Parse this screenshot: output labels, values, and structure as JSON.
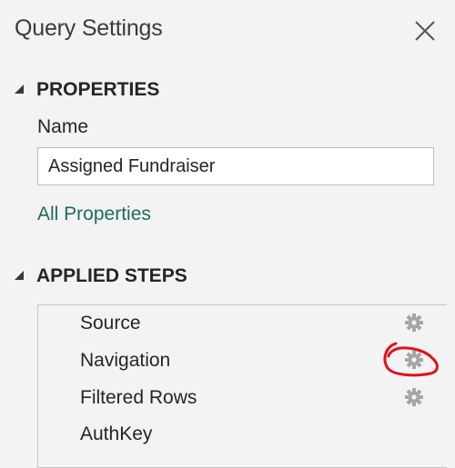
{
  "panel": {
    "title": "Query Settings",
    "close_icon": "close-icon"
  },
  "properties": {
    "header": "PROPERTIES",
    "name_label": "Name",
    "name_value": "Assigned Fundraiser",
    "all_properties_link": "All Properties"
  },
  "applied_steps": {
    "header": "APPLIED STEPS",
    "items": [
      {
        "label": "Source",
        "gear": true
      },
      {
        "label": "Navigation",
        "gear": true,
        "highlighted": true
      },
      {
        "label": "Filtered Rows",
        "gear": true
      },
      {
        "label": "AuthKey",
        "gear": false
      }
    ]
  },
  "colors": {
    "link": "#1e6b5d",
    "annotation": "#e0101a",
    "gear": "#a6a6a6"
  }
}
